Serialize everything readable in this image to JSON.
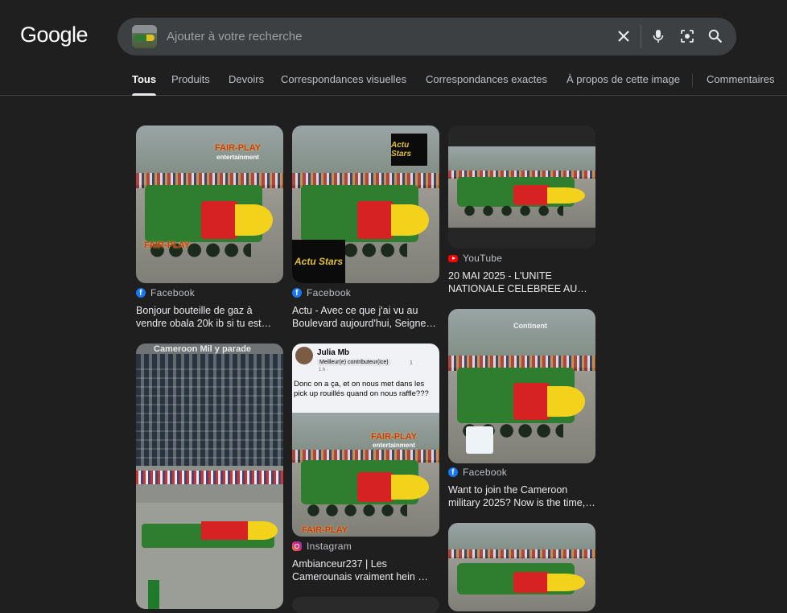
{
  "header": {
    "logo": "Google",
    "search_placeholder": "Ajouter à votre recherche"
  },
  "tabs": [
    {
      "label": "Tous",
      "active": true
    },
    {
      "label": "Produits"
    },
    {
      "label": "Devoirs"
    },
    {
      "label": "Correspondances visuelles"
    },
    {
      "label": "Correspondances exactes"
    },
    {
      "label": "À propos de cette image"
    },
    {
      "label": "Commentaires"
    }
  ],
  "results": [
    {
      "source": "Facebook",
      "source_icon": "facebook-icon",
      "title": "Bonjour bouteille de gaz à vendre obala 20k ib si tu est…",
      "watermark_top": "FAIR-PLAY",
      "watermark_sub": "entertainment",
      "watermark_bottom": "FAIR-PLAY"
    },
    {
      "source": "Facebook",
      "source_icon": "facebook-icon",
      "title": "Actu - Avec ce que j'ai vu au Boulevard aujourd'hui, Seigne…",
      "badge_top": "Actu Stars",
      "badge_bottom": "Actu Stars"
    },
    {
      "source": "YouTube",
      "source_icon": "youtube-icon",
      "title": "20 MAI 2025 - L'UNITE NATIONALE CELEBREE AU…"
    },
    {
      "source": "Facebook",
      "source_icon": "facebook-icon",
      "title": "Want to join the Cameroon military 2025? Now is the time,…",
      "overlay_text": "Continent"
    },
    {
      "overlay_text": "Cameroon Mil    y parade"
    },
    {
      "source": "Instagram",
      "source_icon": "instagram-icon",
      "title": "Ambianceur237 | Les Camerounais vraiment hein …",
      "post_author": "Julia Mb",
      "post_badge": "Meilleur(e) contributeur(ice)",
      "post_time": "1 h ·",
      "post_count": "1",
      "post_text": "Donc on a ça, et on nous met dans les pick up rouillés quand on nous raffle???",
      "watermark": "FAIR-PLAY",
      "watermark_sub": "entertainment",
      "watermark_bottom": "FAIR-PLAY"
    }
  ],
  "colors": {
    "background": "#1f1f1f",
    "searchbox": "#3c4043",
    "tank_green": "#2f7d2f",
    "rocket_red": "#d62222",
    "rocket_yellow": "#f2d21b",
    "facebook": "#1877f2",
    "youtube": "#ff0000"
  }
}
